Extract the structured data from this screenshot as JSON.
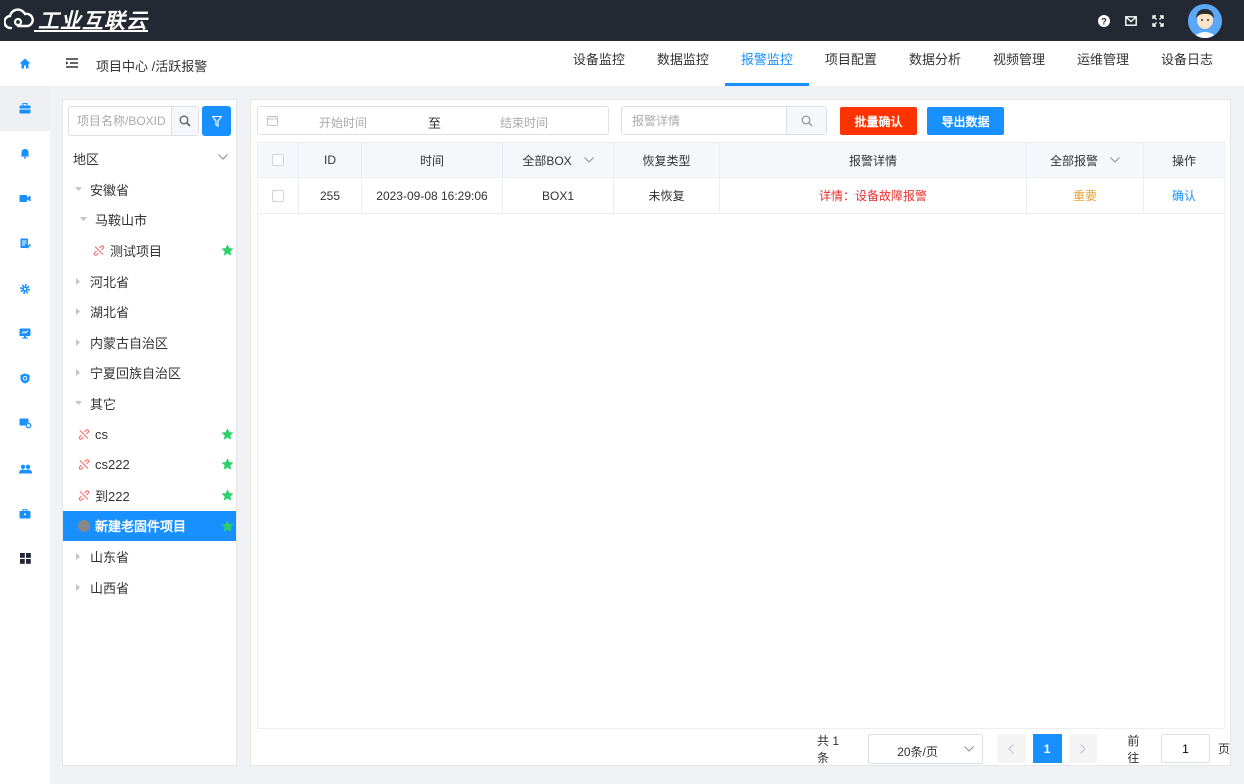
{
  "app": {
    "logo_text": "工业互联云"
  },
  "header": {
    "breadcrumb": "项目中心 /活跃报警"
  },
  "tabs": [
    {
      "label": "设备监控"
    },
    {
      "label": "数据监控"
    },
    {
      "label": "报警监控",
      "active": true
    },
    {
      "label": "项目配置"
    },
    {
      "label": "数据分析"
    },
    {
      "label": "视频管理"
    },
    {
      "label": "运维管理"
    },
    {
      "label": "设备日志"
    }
  ],
  "tree_panel": {
    "search_placeholder": "项目名称/BOXID",
    "region_label": "地区",
    "nodes": [
      {
        "label": "安徽省",
        "level": 0,
        "expanded": true
      },
      {
        "label": "马鞍山市",
        "level": 1,
        "expanded": true
      },
      {
        "label": "测试项目",
        "level": 2,
        "leaf": true,
        "star": true
      },
      {
        "label": "河北省",
        "level": 0
      },
      {
        "label": "湖北省",
        "level": 0
      },
      {
        "label": "内蒙古自治区",
        "level": 0
      },
      {
        "label": "宁夏回族自治区",
        "level": 0
      },
      {
        "label": "其它",
        "level": 0,
        "expanded": true
      },
      {
        "label": "cs",
        "level": 1,
        "leaf": true,
        "star": true
      },
      {
        "label": "cs222",
        "level": 1,
        "leaf": true,
        "star": true
      },
      {
        "label": "到222",
        "level": 1,
        "leaf": true,
        "star": true
      },
      {
        "label": "新建老固件项目",
        "level": 1,
        "leaf": true,
        "star": true,
        "selected": true
      },
      {
        "label": "山东省",
        "level": 0
      },
      {
        "label": "山西省",
        "level": 0
      }
    ]
  },
  "filters": {
    "start_placeholder": "开始时间",
    "range_separator": "至",
    "end_placeholder": "结束时间",
    "detail_placeholder": "报警详情",
    "batch_confirm_label": "批量确认",
    "export_label": "导出数据"
  },
  "table": {
    "columns": {
      "id": "ID",
      "time": "时间",
      "box": "全部BOX",
      "recovery": "恢复类型",
      "detail": "报警详情",
      "level": "全部报警",
      "action": "操作"
    },
    "rows": [
      {
        "id": "255",
        "time": "2023-09-08 16:29:06",
        "box": "BOX1",
        "recovery": "未恢复",
        "detail": "详情：设备故障报警",
        "level": "重要",
        "action": "确认"
      }
    ]
  },
  "pagination": {
    "total_text": "共 1 条",
    "page_size": "20条/页",
    "current_page": "1",
    "goto_label": "前往",
    "goto_value": "1",
    "page_unit": "页"
  },
  "colors": {
    "topbar": "#232833",
    "primary": "#1890ff",
    "danger": "#ff3300",
    "star": "#2fcf6b",
    "alarm_text": "#e8302f",
    "level_text": "#e6a23c"
  }
}
